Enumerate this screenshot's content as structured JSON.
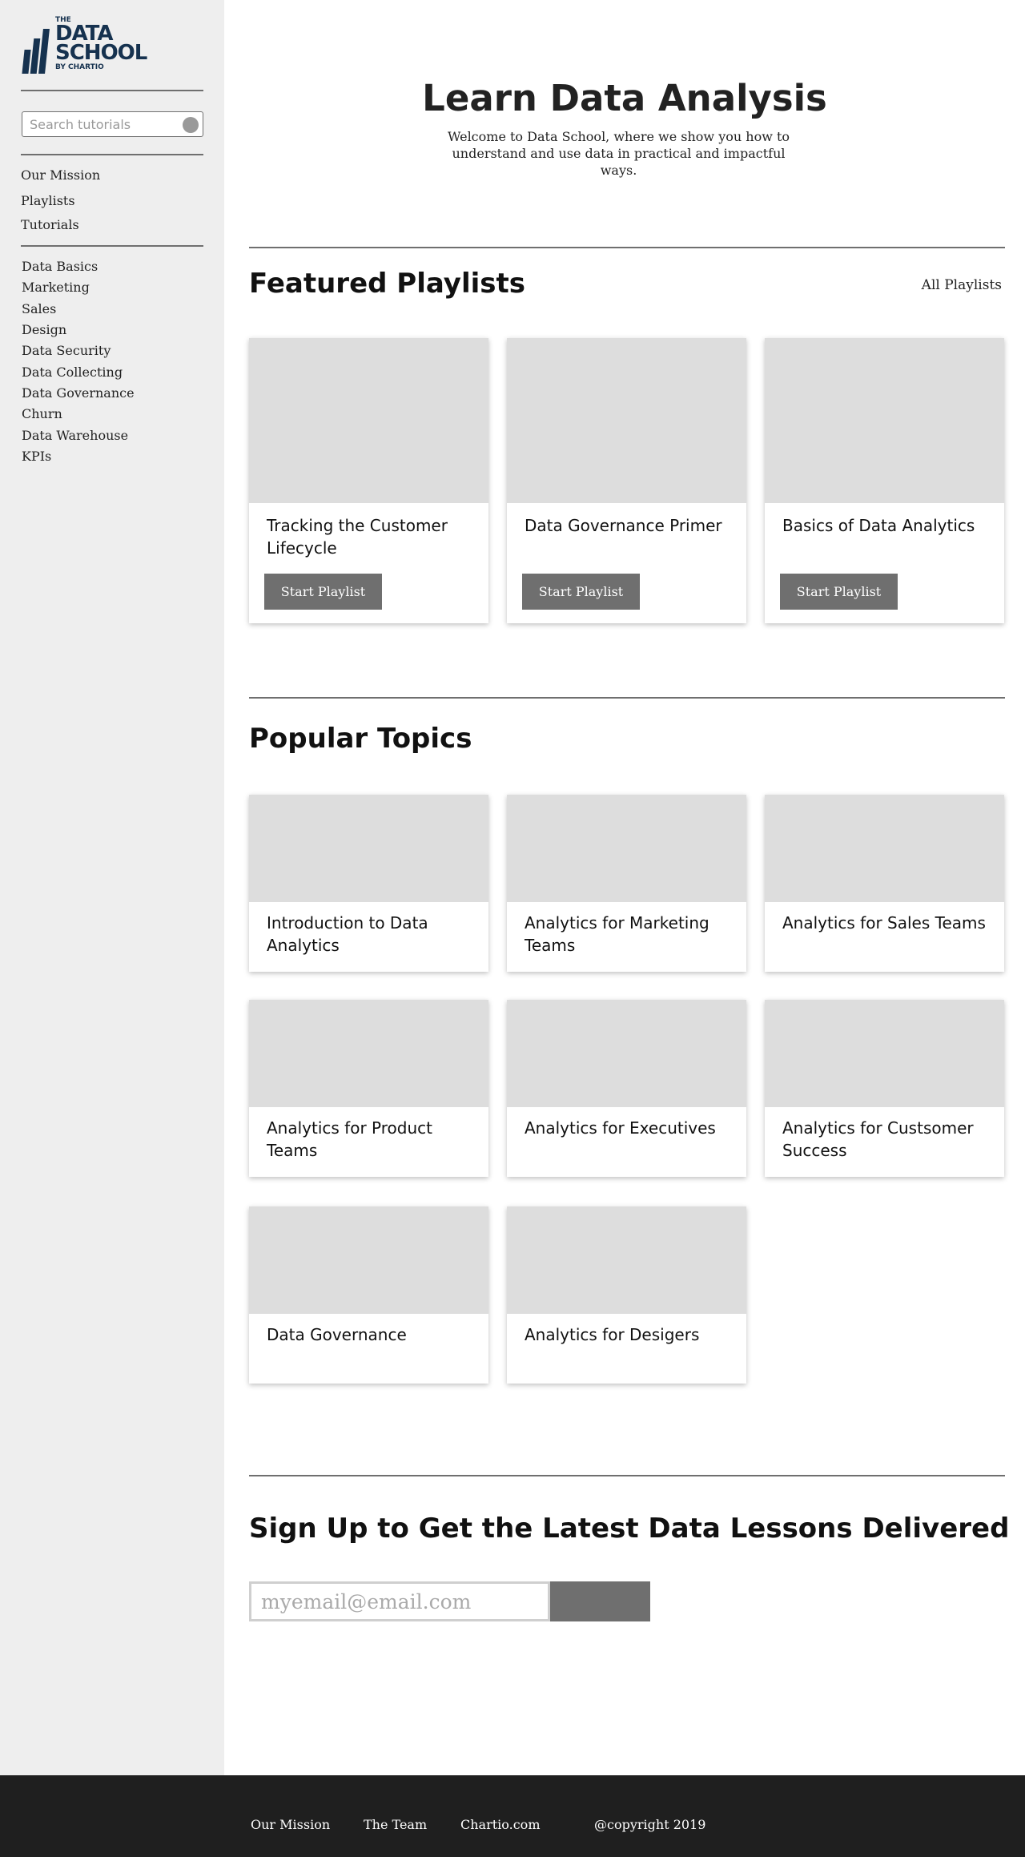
{
  "logo": {
    "the": "THE",
    "line1": "DATA",
    "line2": "SCHOOL",
    "by": "BY CHARTIO"
  },
  "sidebar": {
    "search_placeholder": "Search tutorials",
    "main_links": [
      "Our Mission",
      "Playlists",
      "Tutorials"
    ],
    "categories": [
      "Data Basics",
      "Marketing",
      "Sales",
      "Design",
      "Data Security",
      "Data Collecting",
      "Data Governance",
      "Churn",
      "Data Warehouse",
      "KPIs"
    ]
  },
  "hero": {
    "title": "Learn Data Analysis",
    "subtitle": "Welcome to Data School, where we show you how to understand and use data in practical and impactful ways."
  },
  "featured": {
    "title": "Featured Playlists",
    "all_link": "All Playlists",
    "button_label": "Start Playlist",
    "playlists": [
      "Tracking the Customer Lifecycle",
      "Data Governance Primer",
      "Basics of Data Analytics"
    ]
  },
  "popular": {
    "title": "Popular Topics",
    "topics": [
      "Introduction to Data Analytics",
      "Analytics for Marketing Teams",
      "Analytics for Sales Teams",
      "Analytics for Product Teams",
      "Analytics for Executives",
      "Analytics for Custsomer Success",
      "Data Governance",
      "Analytics for Desigers"
    ]
  },
  "signup": {
    "title": "Sign Up to Get the Latest Data Lessons Delivered",
    "email_placeholder": "myemail@email.com"
  },
  "footer": {
    "links": [
      "Our Mission",
      "The Team",
      "Chartio.com",
      "@copyright 2019"
    ]
  },
  "colors": {
    "sidebar_bg": "#eeeeee",
    "brand": "#16324f",
    "button": "#6f6f6f",
    "image_placeholder": "#dddddd",
    "footer_bg": "#1f1f1f"
  }
}
